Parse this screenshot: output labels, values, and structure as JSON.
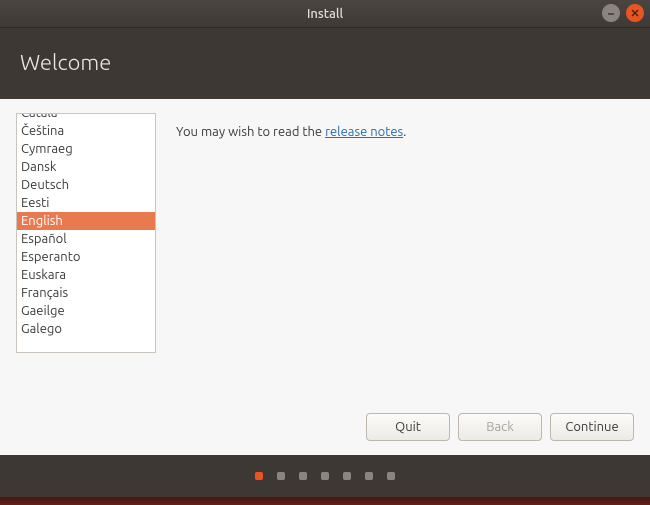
{
  "titlebar": {
    "title": "Install"
  },
  "header": {
    "title": "Welcome"
  },
  "languages": {
    "items": [
      "Català",
      "Čeština",
      "Cymraeg",
      "Dansk",
      "Deutsch",
      "Eesti",
      "English",
      "Español",
      "Esperanto",
      "Euskara",
      "Français",
      "Gaeilge",
      "Galego"
    ],
    "selected_index": 6
  },
  "notes": {
    "prefix": "You may wish to read the ",
    "link": "release notes",
    "suffix": "."
  },
  "buttons": {
    "quit": "Quit",
    "back": "Back",
    "continue": "Continue"
  },
  "progress": {
    "total": 7,
    "active_index": 0
  }
}
